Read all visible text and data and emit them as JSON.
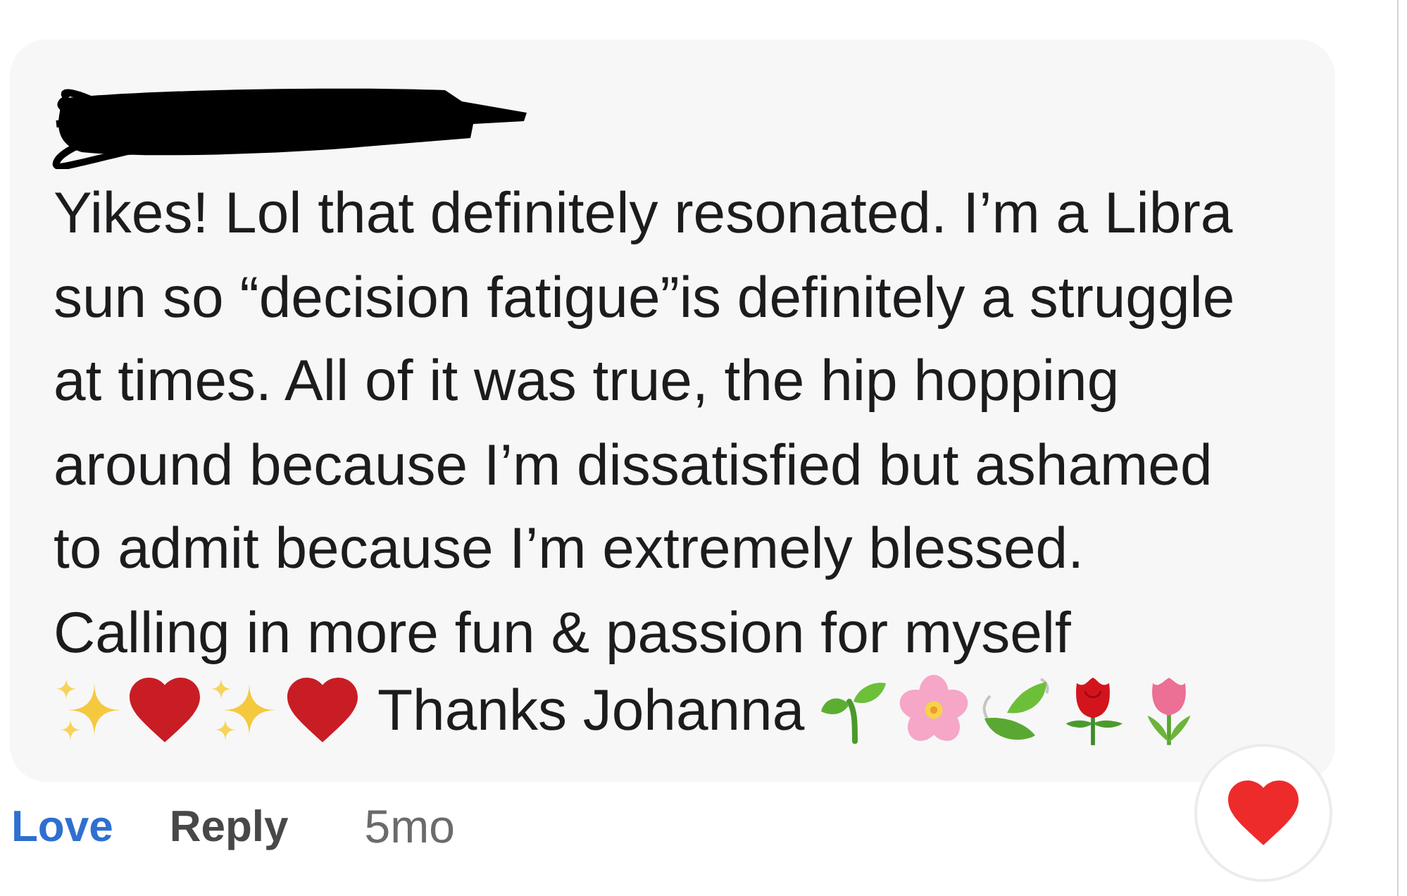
{
  "comment": {
    "body": "Yikes! Lol that definitely resonated. I’m a Libra\nsun so “decision fatigue”is definitely a struggle\nat times. All of it was true, the hip hopping\naround because I’m dissatisfied but ashamed\nto admit because I’m extremely blessed.\nCalling in more fun & passion for myself",
    "closing": "Thanks Johanna"
  },
  "actions": [
    {
      "label": "Love",
      "selected": true
    },
    {
      "label": "Reply",
      "selected": false
    }
  ],
  "timestamp": "5mo"
}
